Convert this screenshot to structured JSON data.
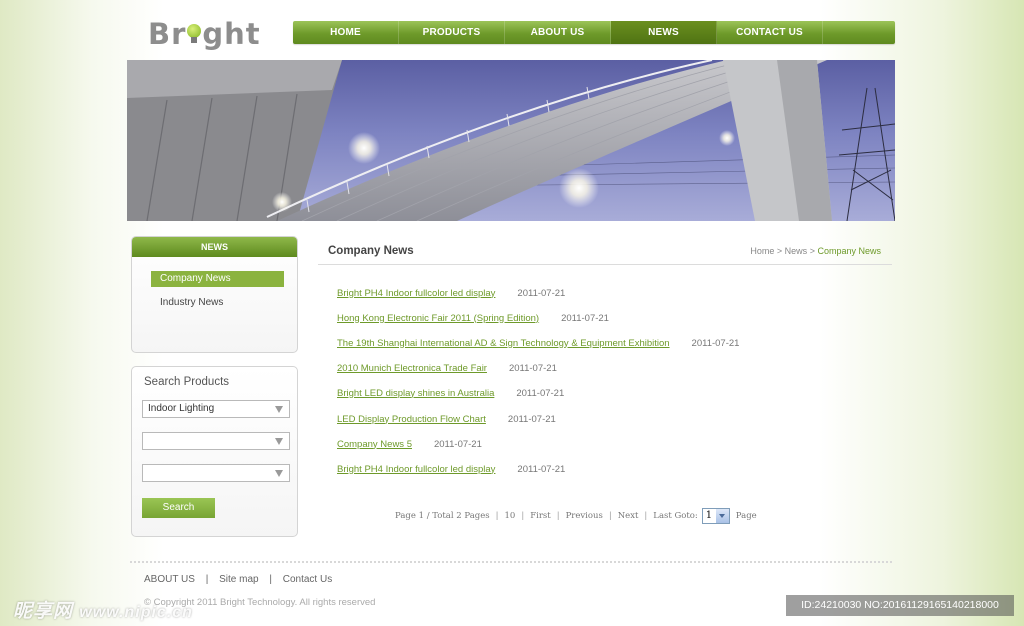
{
  "logo": {
    "pre": "Br",
    "post": "ght"
  },
  "nav": [
    {
      "label": "HOME"
    },
    {
      "label": "PRODUCTS"
    },
    {
      "label": "ABOUT US"
    },
    {
      "label": "NEWS",
      "active": true
    },
    {
      "label": "CONTACT US"
    }
  ],
  "sidebar": {
    "news_title": "NEWS",
    "news_items": [
      {
        "label": "Company News",
        "active": true
      },
      {
        "label": "Industry News"
      }
    ],
    "search": {
      "title": "Search Products",
      "select1": "Indoor Lighting",
      "select2": "",
      "select3": "",
      "button": "Search"
    }
  },
  "main": {
    "title": "Company News",
    "breadcrumb": {
      "home": "Home",
      "sep": ">",
      "section": "News",
      "current": "Company News"
    },
    "news": [
      {
        "title": "Bright PH4 Indoor fullcolor led display",
        "date": "2011-07-21"
      },
      {
        "title": "Hong Kong Electronic Fair 2011 (Spring Edition)",
        "date": "2011-07-21"
      },
      {
        "title": "The 19th Shanghai International AD & Sign Technology & Equipment Exhibition",
        "date": "2011-07-21"
      },
      {
        "title": "2010 Munich Electronica Trade Fair",
        "date": "2011-07-21"
      },
      {
        "title": "Bright LED display shines in Australia",
        "date": "2011-07-21"
      },
      {
        "title": "LED Display Production Flow Chart",
        "date": "2011-07-21"
      },
      {
        "title": "Company News 5",
        "date": "2011-07-21"
      },
      {
        "title": "Bright PH4 Indoor fullcolor led display",
        "date": "2011-07-21"
      }
    ],
    "pager": {
      "summary": "Page 1 / Total 2 Pages",
      "per_page": "10",
      "first": "First",
      "previous": "Previous",
      "next": "Next",
      "last_goto": "Last Goto:",
      "goto_value": "1",
      "page": "Page"
    }
  },
  "footer": {
    "links": [
      "ABOUT US",
      "Site map",
      "Contact Us"
    ],
    "copyright": "© Copyright 2011 Bright Technology. All rights reserved"
  },
  "watermark": {
    "text": "昵享网",
    "url": "www.nipic.cn"
  },
  "image_id": "ID:24210030 NO:20161129165140218000",
  "colors": {
    "accent": "#6e9a2a",
    "nav": "#7aa532"
  }
}
